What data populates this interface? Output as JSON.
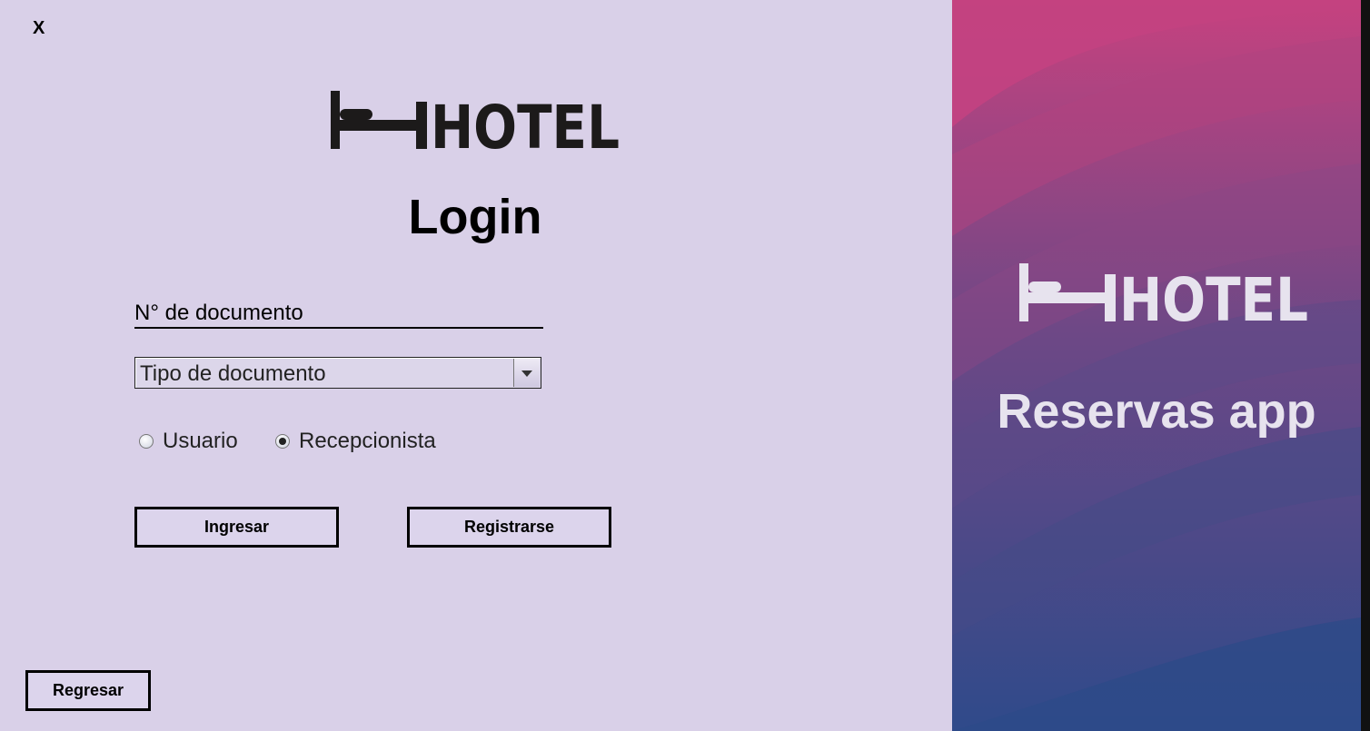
{
  "window": {
    "close_label": "X"
  },
  "brand": {
    "logo_text": "HOTEL"
  },
  "login": {
    "title": "Login",
    "document_number_placeholder": "N° de documento",
    "document_type_selected": "Tipo de documento",
    "radio_user_label": "Usuario",
    "radio_receptionist_label": "Recepcionista",
    "selected_role": "Recepcionista",
    "ingresar_label": "Ingresar",
    "registrarse_label": "Registrarse",
    "regresar_label": "Regresar"
  },
  "side_panel": {
    "logo_text": "HOTEL",
    "app_name": "Reservas app"
  },
  "colors": {
    "left_bg": "#d9d0e8",
    "gradient_top": "#c6427f",
    "gradient_bottom": "#2f4a8a"
  }
}
